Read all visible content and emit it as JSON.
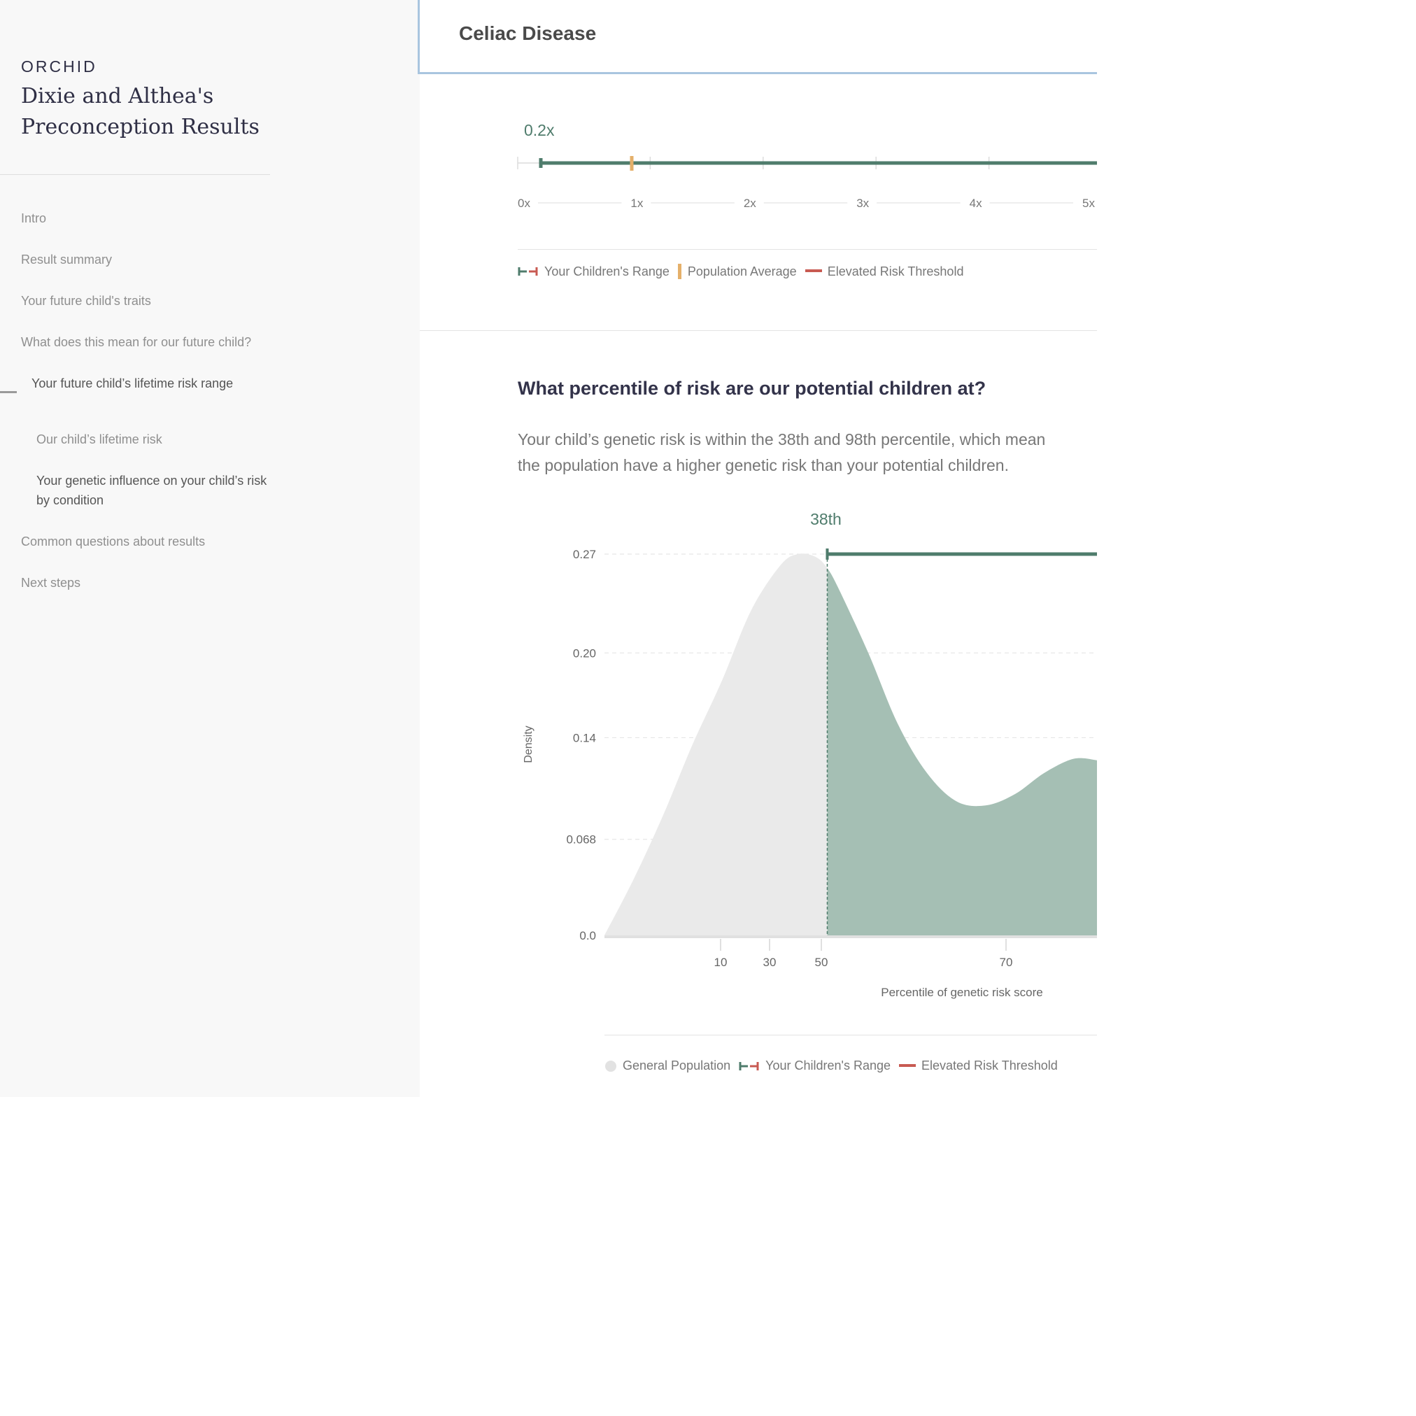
{
  "sidebar": {
    "brand": "ORCHID",
    "report_title": "Dixie and Althea's Preconception Results",
    "nav": [
      {
        "label": "Intro"
      },
      {
        "label": "Result summary"
      },
      {
        "label": "Your future child's traits"
      },
      {
        "label": "What does this mean for our future child?"
      },
      {
        "label": "Your future child’s lifetime risk range"
      },
      {
        "label": "Our child’s lifetime risk"
      },
      {
        "label": "Your genetic influence on your child’s risk by condition"
      },
      {
        "label": "Common questions about results"
      },
      {
        "label": "Next steps"
      }
    ]
  },
  "header": {
    "title": "Celiac Disease"
  },
  "relative_risk": {
    "value_label": "0.2x",
    "range_start": 0.2,
    "population_average": 1.0,
    "ticks": [
      "0x",
      "1x",
      "2x",
      "3x",
      "4x",
      "5x"
    ],
    "legend": {
      "range": "Your Children's Range",
      "average": "Population Average",
      "threshold": "Elevated Risk Threshold"
    }
  },
  "percentile": {
    "heading": "What percentile of risk are our potential children at?",
    "body_line1": "Your child’s genetic risk is within the 38th and 98th percentile, which mean",
    "body_line2": "the population have a higher genetic risk than your potential children."
  },
  "chart_data": {
    "type": "area",
    "marker_label": "38th",
    "range_start_percentile": 38,
    "xlabel": "Percentile of genetic risk score",
    "ylabel": "Density",
    "x_ticks": [
      10,
      30,
      50,
      70
    ],
    "y_ticks": [
      "0.27",
      "0.20",
      "0.14",
      "0.068",
      "0.0"
    ],
    "ylim": [
      0,
      0.27
    ],
    "series": [
      {
        "name": "General Population",
        "x": [
          0,
          5,
          10,
          15,
          20,
          25,
          30,
          33,
          36,
          38,
          40,
          45,
          50,
          55,
          60,
          65,
          70,
          75,
          80,
          84
        ],
        "y": [
          0.0,
          0.04,
          0.085,
          0.135,
          0.18,
          0.23,
          0.262,
          0.27,
          0.268,
          0.26,
          0.245,
          0.2,
          0.15,
          0.115,
          0.095,
          0.092,
          0.1,
          0.115,
          0.125,
          0.124
        ]
      }
    ],
    "legend": {
      "population": "General Population",
      "range": "Your Children's Range",
      "threshold": "Elevated Risk Threshold"
    }
  },
  "colors": {
    "range": "#4f7c6c",
    "average": "#e5b06a",
    "threshold": "#c85a52",
    "population_fill": "#eaeaea",
    "range_fill": "#a5bfb4"
  }
}
